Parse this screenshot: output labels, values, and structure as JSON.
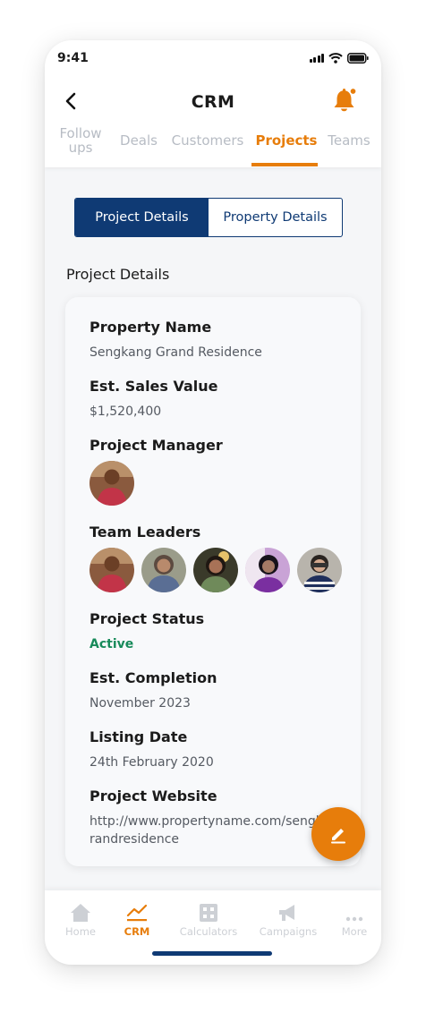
{
  "status_bar": {
    "time": "9:41"
  },
  "header": {
    "title": "CRM",
    "tabs": [
      {
        "label": "Follow ups"
      },
      {
        "label": "Deals"
      },
      {
        "label": "Customers"
      },
      {
        "label": "Projects"
      },
      {
        "label": "Teams"
      }
    ],
    "active_tab": "Projects"
  },
  "segmented": {
    "project_details": "Project Details",
    "property_details": "Property Details",
    "selected": "Project Details"
  },
  "section_title": "Project Details",
  "details": {
    "property_name": {
      "label": "Property Name",
      "value": "Sengkang Grand Residence"
    },
    "sales_value": {
      "label": "Est. Sales Value",
      "value": "$1,520,400"
    },
    "project_manager": {
      "label": "Project Manager"
    },
    "team_leaders": {
      "label": "Team Leaders"
    },
    "project_status": {
      "label": "Project Status",
      "value": "Active"
    },
    "completion": {
      "label": "Est. Completion",
      "value": "November 2023"
    },
    "listing_date": {
      "label": "Listing Date",
      "value": "24th February 2020"
    },
    "website": {
      "label": "Project Website",
      "value_line1": "http://www.propertyname.com/sengka",
      "value_line2": "randresidence"
    }
  },
  "bottom_nav": {
    "items": [
      {
        "label": "Home",
        "icon": "home-icon"
      },
      {
        "label": "CRM",
        "icon": "trend-icon"
      },
      {
        "label": "Calculators",
        "icon": "calculator-icon"
      },
      {
        "label": "Campaigns",
        "icon": "megaphone-icon"
      },
      {
        "label": "More",
        "icon": "more-icon"
      }
    ],
    "active": "CRM"
  },
  "colors": {
    "accent": "#e77d0b",
    "navy": "#0f3a74",
    "status_active": "#178a5a"
  }
}
